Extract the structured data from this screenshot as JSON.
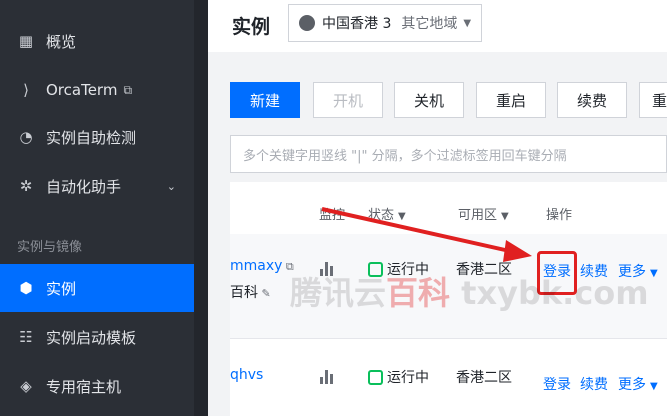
{
  "sidebar": {
    "items": [
      {
        "label": "概览",
        "icon": "grid-icon"
      },
      {
        "label": "OrcaTerm",
        "icon": "terminal-icon",
        "ext": "⧉"
      },
      {
        "label": "实例自助检测",
        "icon": "check-circle-icon"
      },
      {
        "label": "自动化助手",
        "icon": "gear-icon",
        "chevron": "⌄"
      },
      {
        "label": "实例",
        "icon": "cube-icon"
      },
      {
        "label": "实例启动模板",
        "icon": "template-icon"
      },
      {
        "label": "专用宿主机",
        "icon": "host-icon"
      }
    ],
    "section_title": "实例与镜像"
  },
  "header": {
    "title": "实例",
    "region": "中国香港 3",
    "region_other": "其它地域"
  },
  "toolbar": {
    "buttons": [
      "新建",
      "开机",
      "关机",
      "重启",
      "续费",
      "重"
    ]
  },
  "search": {
    "placeholder": "多个关键字用竖线 \"|\" 分隔，多个过滤标签用回车键分隔"
  },
  "table": {
    "headers": {
      "monitor": "监控",
      "status": "状态",
      "zone": "可用区",
      "ops": "操作"
    },
    "rows": [
      {
        "id": "mmaxy",
        "name": "百科",
        "status": "运行中",
        "zone": "香港二区",
        "login": "登录",
        "renew": "续费",
        "more": "更多"
      },
      {
        "id": "qhvs",
        "status": "运行中",
        "zone": "香港二区",
        "login": "登录",
        "renew": "续费",
        "more": "更多"
      }
    ]
  },
  "watermark": {
    "a": "腾讯云",
    "b": "百科",
    "c": "txybk.com"
  },
  "colors": {
    "accent": "#006eff",
    "running": "#0abf5b",
    "annotation": "#e02020"
  }
}
